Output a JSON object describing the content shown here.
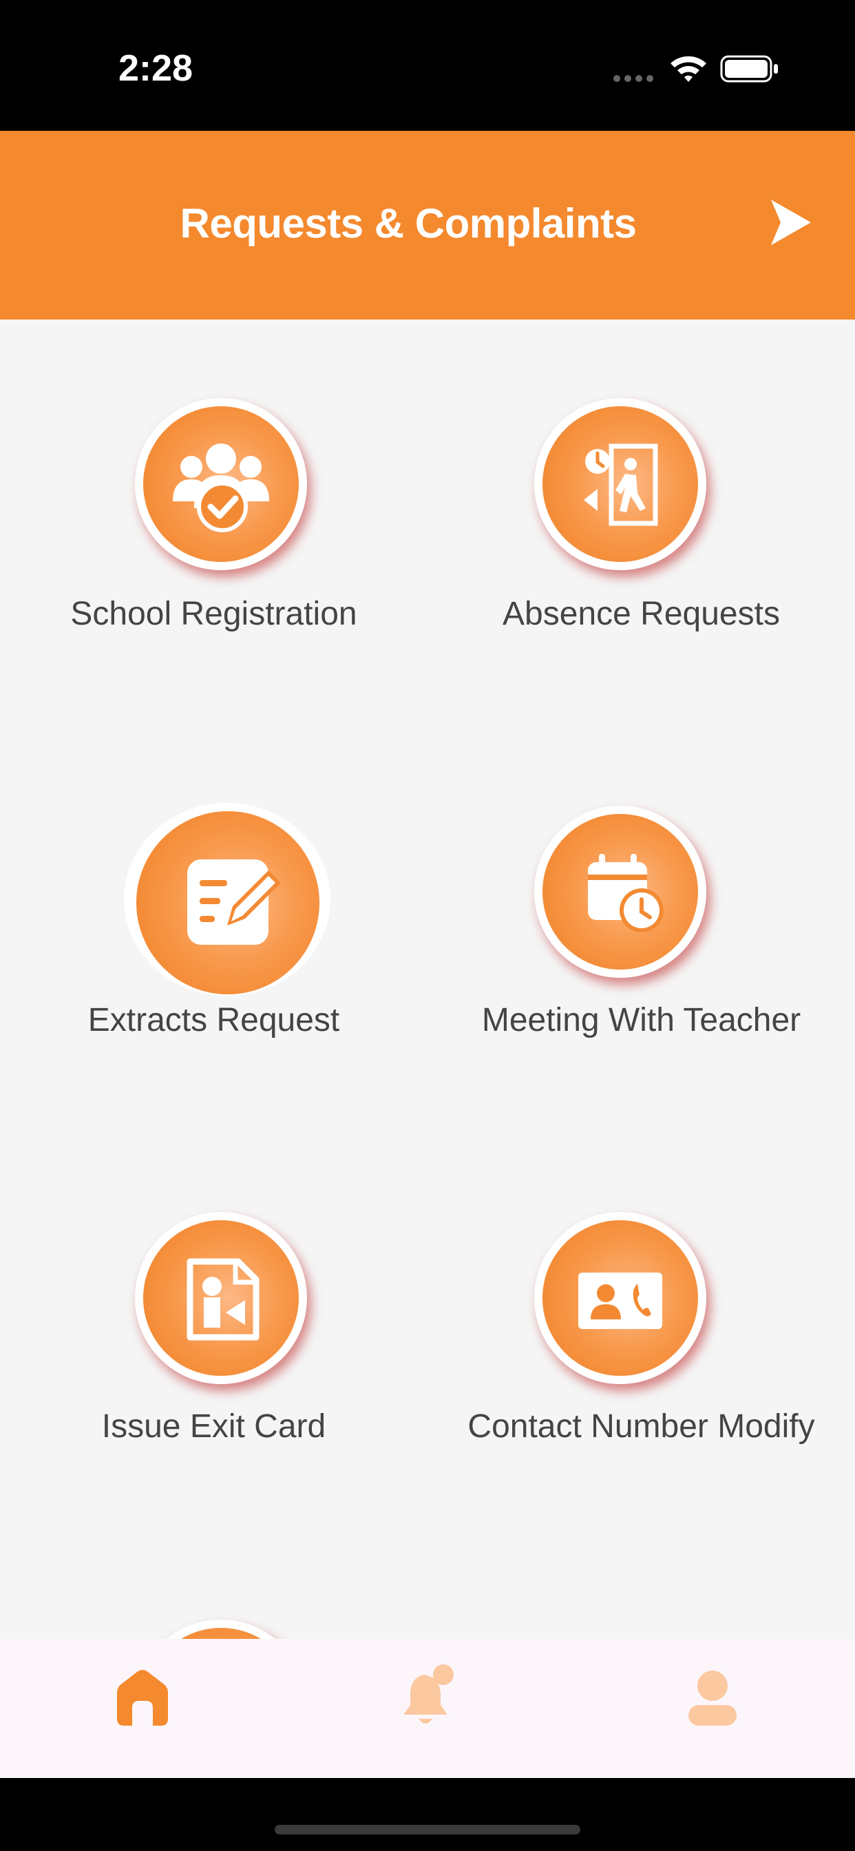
{
  "status_bar": {
    "time": "2:28"
  },
  "header": {
    "title": "Requests & Complaints"
  },
  "tiles": [
    {
      "label": "School Registration",
      "icon": "group-check-icon"
    },
    {
      "label": "Absence Requests",
      "icon": "exit-door-clock-icon"
    },
    {
      "label": "Extracts Request",
      "icon": "document-edit-icon"
    },
    {
      "label": "Meeting With Teacher",
      "icon": "calendar-clock-icon"
    },
    {
      "label": "Issue Exit Card",
      "icon": "card-exit-icon"
    },
    {
      "label": "Contact Number Modify",
      "icon": "contact-card-phone-icon"
    }
  ],
  "bottom_nav": {
    "items": [
      {
        "name": "home",
        "icon": "home-icon",
        "active": true
      },
      {
        "name": "notifications",
        "icon": "bell-icon",
        "active": false
      },
      {
        "name": "profile",
        "icon": "user-icon",
        "active": false
      }
    ]
  },
  "colors": {
    "accent": "#f4892e",
    "background": "#f5f5f5",
    "nav_bg": "#fcf6fb",
    "nav_inactive": "#fcc8a0"
  }
}
